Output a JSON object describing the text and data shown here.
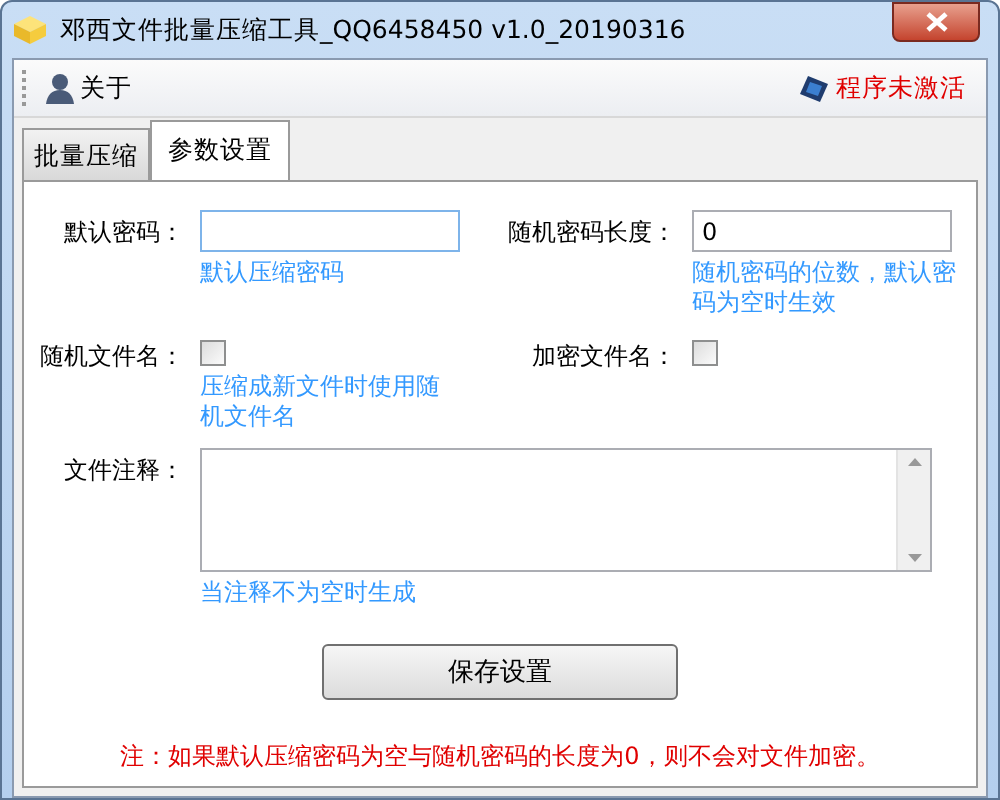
{
  "window": {
    "title": "邓西文件批量压缩工具_QQ6458450 v1.0_20190316"
  },
  "toolbar": {
    "about": "关于",
    "status": "程序未激活"
  },
  "tabs": [
    {
      "label": "批量压缩",
      "selected": false
    },
    {
      "label": "参数设置",
      "selected": true
    }
  ],
  "fields": [
    {
      "kind": "text",
      "label": "默认密码：",
      "hint": "默认压缩密码"
    },
    {
      "kind": "text",
      "label": "随机密码长度：",
      "value": "0",
      "hint": "随机密码的位数，默认密码为空时生效"
    },
    {
      "kind": "checkbox",
      "label": "随机文件名：",
      "checked": false,
      "hint": "压缩成新文件时使用随机文件名"
    },
    {
      "kind": "checkbox",
      "label": "加密文件名：",
      "checked": false
    },
    {
      "kind": "textarea",
      "label": "文件注释：",
      "hint": "当注释不为空时生成"
    }
  ],
  "save_button": "保存设置",
  "note": "注：如果默认压缩密码为空与随机密码的长度为0，则不会对文件加密。"
}
